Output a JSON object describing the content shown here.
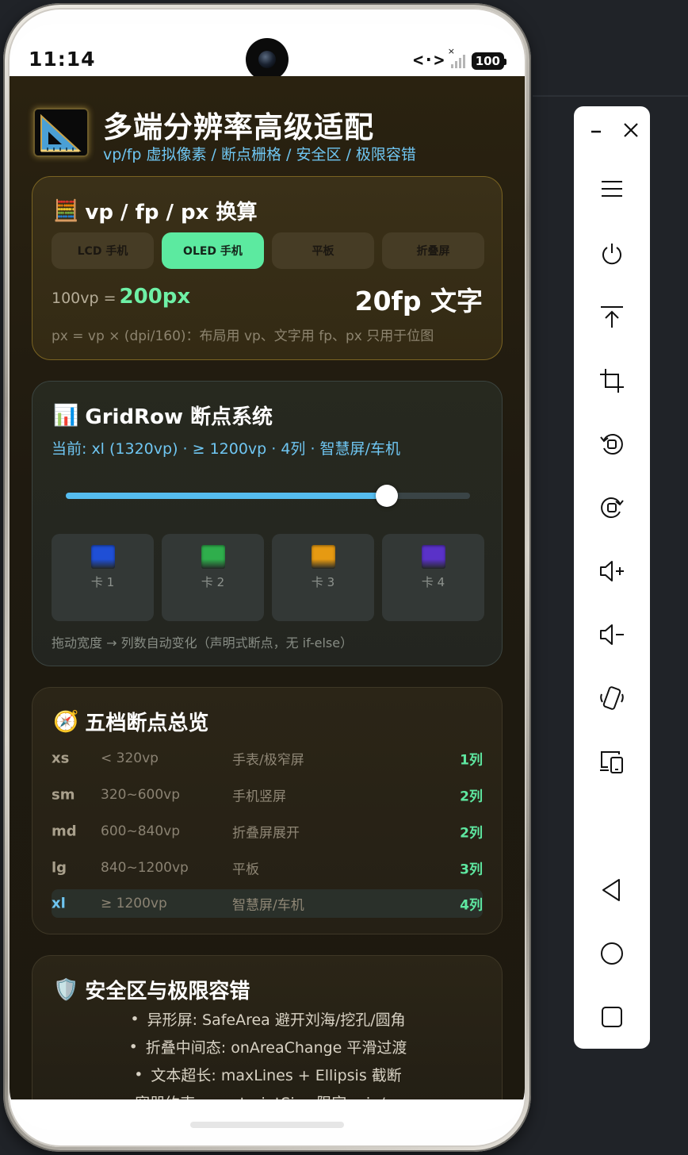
{
  "status_bar": {
    "time": "11:14",
    "network": "<·>",
    "signal_x": "×",
    "battery": "100"
  },
  "header": {
    "title": "多端分辨率高级适配",
    "subtitle": "vp/fp 虚拟像素 / 断点栅格 / 安全区 / 极限容错"
  },
  "converter": {
    "emoji": "🧮",
    "title": "vp / fp / px 换算",
    "tabs": [
      "LCD 手机",
      "OLED 手机",
      "平板",
      "折叠屏"
    ],
    "active_tab": 1,
    "vp_label": "100vp =",
    "px_value": "200px",
    "fp_text": "20fp 文字",
    "note": "px = vp × (dpi/160)：布局用 vp、文字用 fp、px 只用于位图"
  },
  "gridrow": {
    "emoji": "📊",
    "title": "GridRow 断点系统",
    "current": "当前: xl (1320vp) · ≥ 1200vp · 4列 · 智慧屏/车机",
    "slider_fraction": 0.795,
    "cards": [
      {
        "label": "卡 1",
        "color": "#1f4fd6"
      },
      {
        "label": "卡 2",
        "color": "#2fae4c"
      },
      {
        "label": "卡 3",
        "color": "#e69a12"
      },
      {
        "label": "卡 4",
        "color": "#5a32c8"
      }
    ],
    "note": "拖动宽度 → 列数自动变化（声明式断点，无 if-else）"
  },
  "breakpoints": {
    "emoji": "🧭",
    "title": "五档断点总览",
    "rows": [
      {
        "name": "xs",
        "range": "< 320vp",
        "device": "手表/极窄屏",
        "cols": "1列",
        "current": false
      },
      {
        "name": "sm",
        "range": "320~600vp",
        "device": "手机竖屏",
        "cols": "2列",
        "current": false
      },
      {
        "name": "md",
        "range": "600~840vp",
        "device": "折叠屏展开",
        "cols": "2列",
        "current": false
      },
      {
        "name": "lg",
        "range": "840~1200vp",
        "device": "平板",
        "cols": "3列",
        "current": false
      },
      {
        "name": "xl",
        "range": "≥ 1200vp",
        "device": "智慧屏/车机",
        "cols": "4列",
        "current": true
      }
    ]
  },
  "safety": {
    "emoji": "🛡️",
    "title": "安全区与极限容错",
    "items": [
      "异形屏: SafeArea 避开刘海/挖孔/圆角",
      "折叠中间态: onAreaChange 平滑过渡",
      "文本超长: maxLines + Ellipsis 截断",
      "容器约束: constraintSize 限定 min/max"
    ]
  },
  "toolbar": {
    "icons": [
      "minimize-icon",
      "close-icon",
      "menu-icon",
      "power-icon",
      "pin-top-icon",
      "crop-icon",
      "rotate-left-icon",
      "rotate-right-icon",
      "volume-up-icon",
      "volume-down-icon",
      "shake-icon",
      "multi-device-icon",
      "back-icon",
      "home-icon",
      "recent-apps-icon"
    ]
  }
}
